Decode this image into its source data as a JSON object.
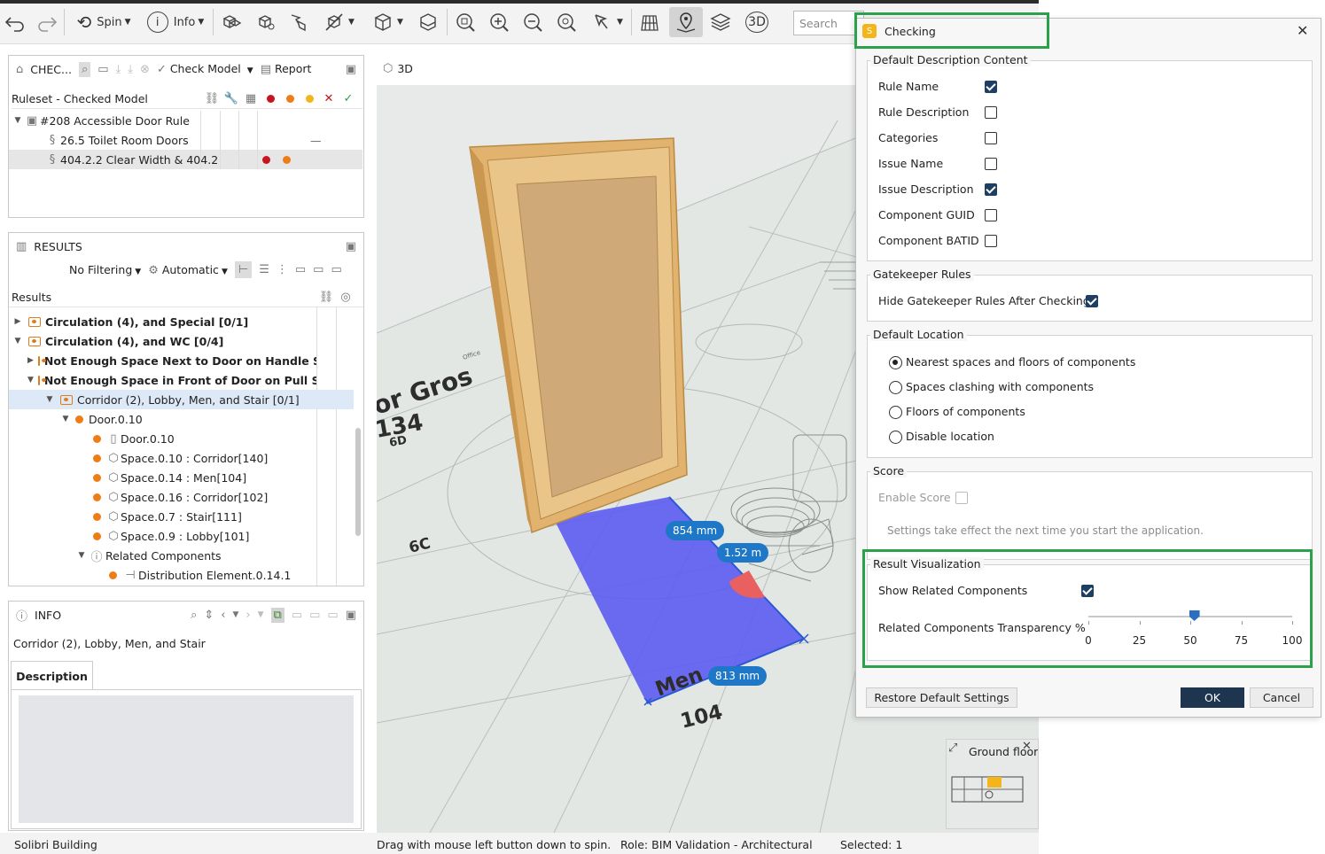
{
  "toolbar": {
    "spin_label": "Spin",
    "info_label": "Info",
    "search_placeholder": "Search",
    "icons": [
      "undo-icon",
      "redo-icon",
      "spin-icon",
      "info-icon",
      "components-icon",
      "isolate-icon",
      "select-area-icon",
      "hide-icon",
      "box-icon",
      "section-icon",
      "zoom-fit-icon",
      "zoom-in-icon",
      "zoom-out-icon",
      "zoom-selected-icon",
      "pointer-icon",
      "floor-icon",
      "location-icon",
      "layers-icon",
      "3d-icon"
    ]
  },
  "checking_panel": {
    "title": "CHEC...",
    "check_model_label": "Check Model",
    "report_label": "Report",
    "ruleset_header": "Ruleset - Checked Model",
    "rules": [
      {
        "label": "#208 Accessible Door Rule"
      },
      {
        "label": "26.5 Toilet Room Doors",
        "status": "—"
      },
      {
        "label": "404.2.2 Clear Width & 404.2"
      }
    ]
  },
  "results_panel": {
    "title": "RESULTS",
    "filter_label": "No Filtering",
    "auto_label": "Automatic",
    "results_header": "Results",
    "items": [
      {
        "label": "Circulation (4), and Special [0/1]"
      },
      {
        "label": "Circulation (4), and WC [0/4]"
      },
      {
        "label": "Not Enough Space Next to Door on Handle Side o"
      },
      {
        "label": "Not Enough Space in Front of Door on Pull Side [("
      },
      {
        "label": "Corridor (2), Lobby, Men, and Stair [0/1]"
      },
      {
        "label": "Door.0.10"
      },
      {
        "label": "Door.0.10"
      },
      {
        "label": "Space.0.10 : Corridor[140]"
      },
      {
        "label": "Space.0.14 : Men[104]"
      },
      {
        "label": "Space.0.16 : Corridor[102]"
      },
      {
        "label": "Space.0.7 : Stair[111]"
      },
      {
        "label": "Space.0.9 : Lobby[101]"
      },
      {
        "label": "Related Components"
      },
      {
        "label": "Distribution Element.0.14.1"
      }
    ]
  },
  "info_panel": {
    "title": "INFO",
    "selection": "Corridor (2), Lobby, Men, and Stair",
    "tab": "Description"
  },
  "viewport": {
    "tab_label": "3D",
    "labels": {
      "room_gross": "or Gros",
      "room_num": "134",
      "tag_6d": "6D",
      "tag_6c": "6C",
      "office": "Office",
      "men": "Men",
      "men_num": "104"
    },
    "measurements": {
      "m1": "854 mm",
      "m2": "1.52 m",
      "m3": "813 mm"
    },
    "minimap_title": "Ground floor"
  },
  "status_bar": {
    "app": "Solibri Building",
    "hint": "Drag with mouse left button down to spin.",
    "role": "Role: BIM Validation - Architectural",
    "selected": "Selected: 1"
  },
  "dialog": {
    "title": "Checking",
    "desc_group": "Default Description Content",
    "desc_options": [
      {
        "label": "Rule Name",
        "checked": true
      },
      {
        "label": "Rule Description",
        "checked": false
      },
      {
        "label": "Categories",
        "checked": false
      },
      {
        "label": "Issue Name",
        "checked": false
      },
      {
        "label": "Issue Description",
        "checked": true
      },
      {
        "label": "Component GUID",
        "checked": false
      },
      {
        "label": "Component BATID",
        "checked": false
      }
    ],
    "gate_group": "Gatekeeper Rules",
    "gate_option": "Hide Gatekeeper Rules After Checking",
    "loc_group": "Default Location",
    "loc_options": [
      "Nearest spaces and floors of components",
      "Spaces clashing with components",
      "Floors of components",
      "Disable location"
    ],
    "score_group": "Score",
    "score_option": "Enable Score",
    "score_note": "Settings take effect the next time you start the application.",
    "vis_group": "Result Visualization",
    "vis_show": "Show Related Components",
    "vis_transparency": "Related Components Transparency %",
    "transparency_value": 52,
    "slider_ticks": [
      "0",
      "25",
      "50",
      "75",
      "100"
    ],
    "restore_label": "Restore Default Settings",
    "ok_label": "OK",
    "cancel_label": "Cancel"
  }
}
